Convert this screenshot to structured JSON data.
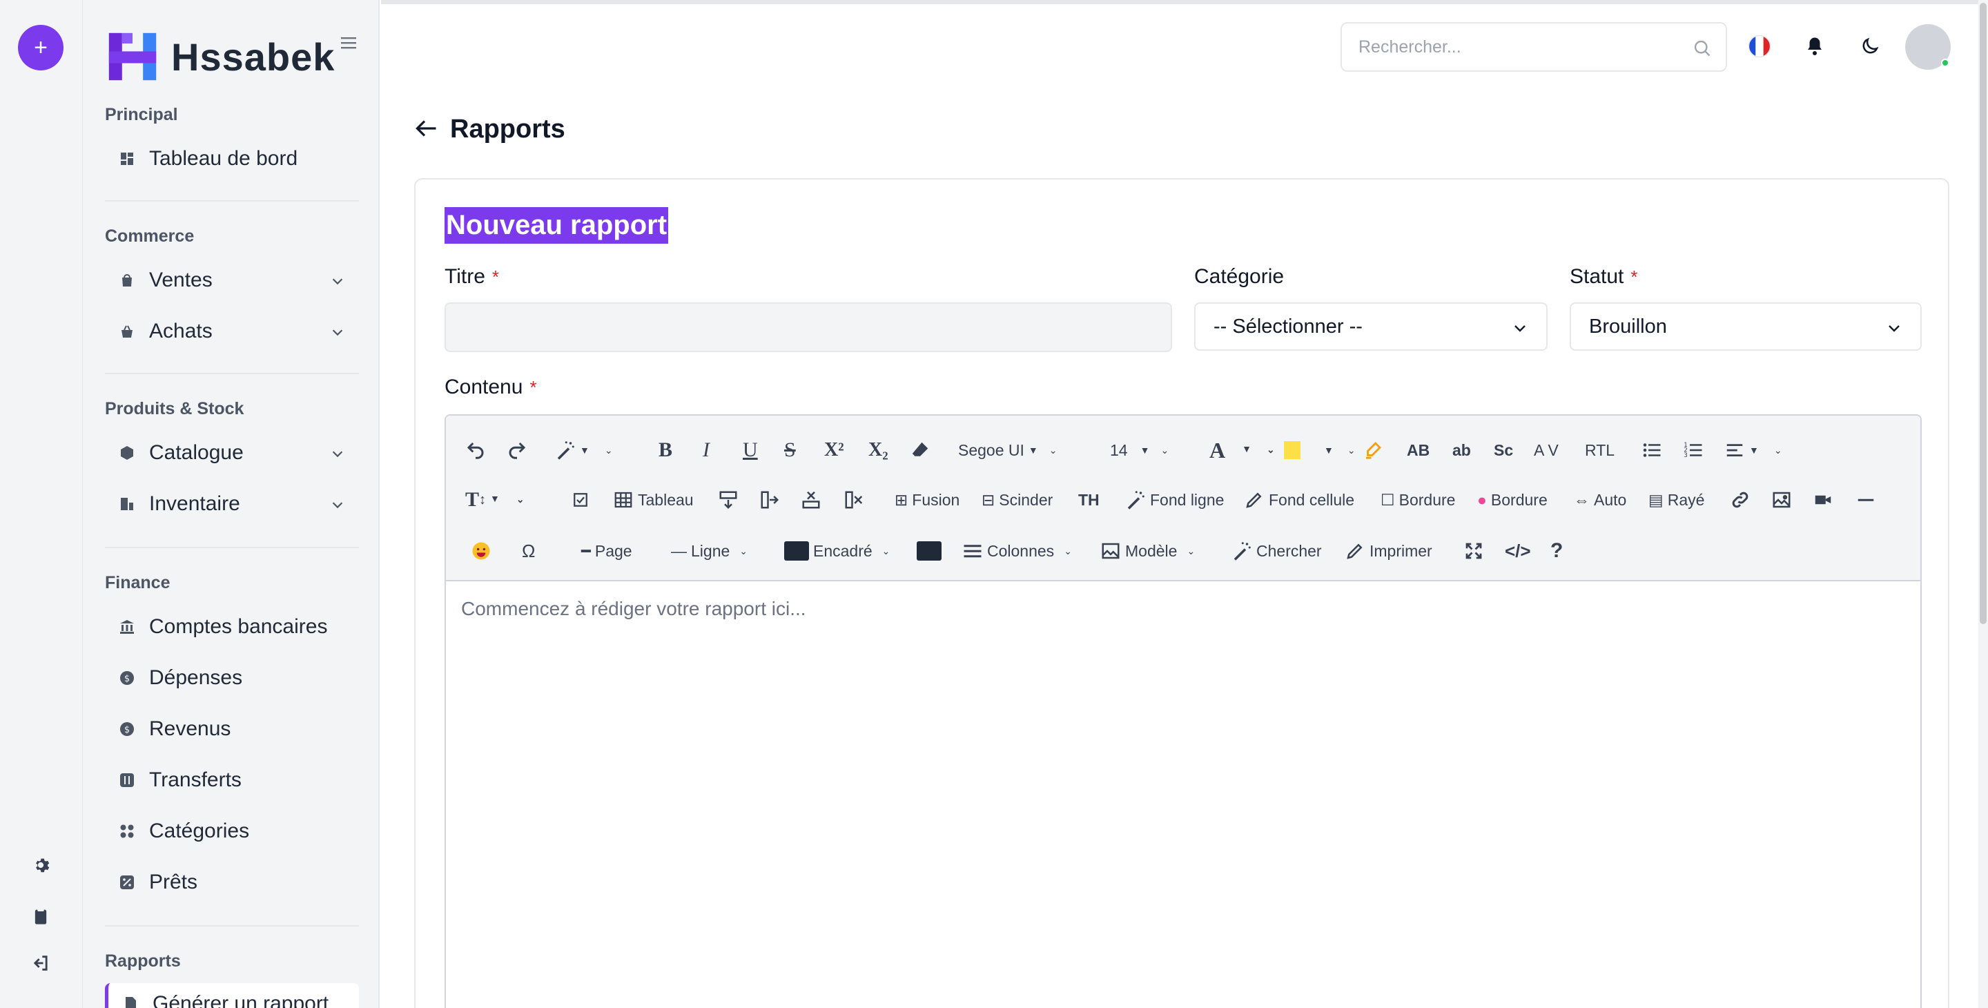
{
  "rail": {
    "add_label": "+",
    "icons": [
      "gear-icon",
      "clipboard-icon",
      "logout-icon"
    ]
  },
  "brand": {
    "name": "Hssabek",
    "logo_icon": "h-logo-icon",
    "logo_colors": [
      "#6d28d9",
      "#3b82f6"
    ]
  },
  "sidebar": {
    "sections": [
      {
        "title": "Principal",
        "items": [
          {
            "label": "Tableau de bord",
            "icon": "dashboard-icon",
            "expandable": false
          }
        ]
      },
      {
        "title": "Commerce",
        "items": [
          {
            "label": "Ventes",
            "icon": "shopping-bag-icon",
            "expandable": true
          },
          {
            "label": "Achats",
            "icon": "basket-icon",
            "expandable": true
          }
        ]
      },
      {
        "title": "Produits & Stock",
        "items": [
          {
            "label": "Catalogue",
            "icon": "box-icon",
            "expandable": true
          },
          {
            "label": "Inventaire",
            "icon": "warehouse-icon",
            "expandable": true
          }
        ]
      },
      {
        "title": "Finance",
        "items": [
          {
            "label": "Comptes bancaires",
            "icon": "bank-icon",
            "expandable": false
          },
          {
            "label": "Dépenses",
            "icon": "coin-icon",
            "expandable": false
          },
          {
            "label": "Revenus",
            "icon": "coin-icon",
            "expandable": false
          },
          {
            "label": "Transferts",
            "icon": "transfer-icon",
            "expandable": false
          },
          {
            "label": "Catégories",
            "icon": "grid-icon",
            "expandable": false
          },
          {
            "label": "Prêts",
            "icon": "percent-icon",
            "expandable": false
          }
        ]
      },
      {
        "title": "Rapports",
        "items": [
          {
            "label": "Générer un rapport",
            "icon": "file-icon",
            "expandable": false,
            "active": true
          }
        ]
      }
    ]
  },
  "topbar": {
    "search_placeholder": "Rechercher...",
    "icons": [
      "search-icon",
      "flag-fr-icon",
      "bell-icon",
      "moon-icon"
    ],
    "avatar_label": ""
  },
  "page": {
    "back_icon": "arrow-left-icon",
    "title": "Rapports"
  },
  "form": {
    "title": "Nouveau rapport",
    "fields": {
      "titre": {
        "label": "Titre",
        "required": "*",
        "value": ""
      },
      "categorie": {
        "label": "Catégorie",
        "value": "-- Sélectionner --"
      },
      "statut": {
        "label": "Statut",
        "required": "*",
        "value": "Brouillon"
      },
      "contenu": {
        "label": "Contenu",
        "required": "*"
      }
    },
    "editor": {
      "placeholder": "Commencez à rédiger votre rapport ici...",
      "font_family": "Segoe UI",
      "font_size": "14",
      "toolbar_labels": {
        "bold": "B",
        "italic": "I",
        "underline": "U",
        "strike": "S",
        "sup": "X²",
        "sub": "X₂",
        "upper": "AB",
        "lower": "ab",
        "smallcaps": "Sc",
        "spacing": "A V",
        "rtl": "RTL",
        "tableau": "Tableau",
        "fusion": "Fusion",
        "scinder": "Scinder",
        "th": "TH",
        "fond_ligne": "Fond ligne",
        "fond_cellule": "Fond cellule",
        "bordure1": "Bordure",
        "bordure2": "Bordure",
        "auto": "Auto",
        "raye": "Rayé",
        "omega": "Ω",
        "page": "Page",
        "ligne": "Ligne",
        "encadre": "Encadré",
        "colonnes": "Colonnes",
        "modele": "Modèle",
        "chercher": "Chercher",
        "imprimer": "Imprimer",
        "code": "</>",
        "help": "?"
      },
      "colors": {
        "highlight": "#fde047",
        "dark_box": "#1f2937"
      }
    }
  },
  "colors": {
    "accent": "#7c3aed",
    "required": "#dc2626",
    "online": "#22c55e"
  }
}
